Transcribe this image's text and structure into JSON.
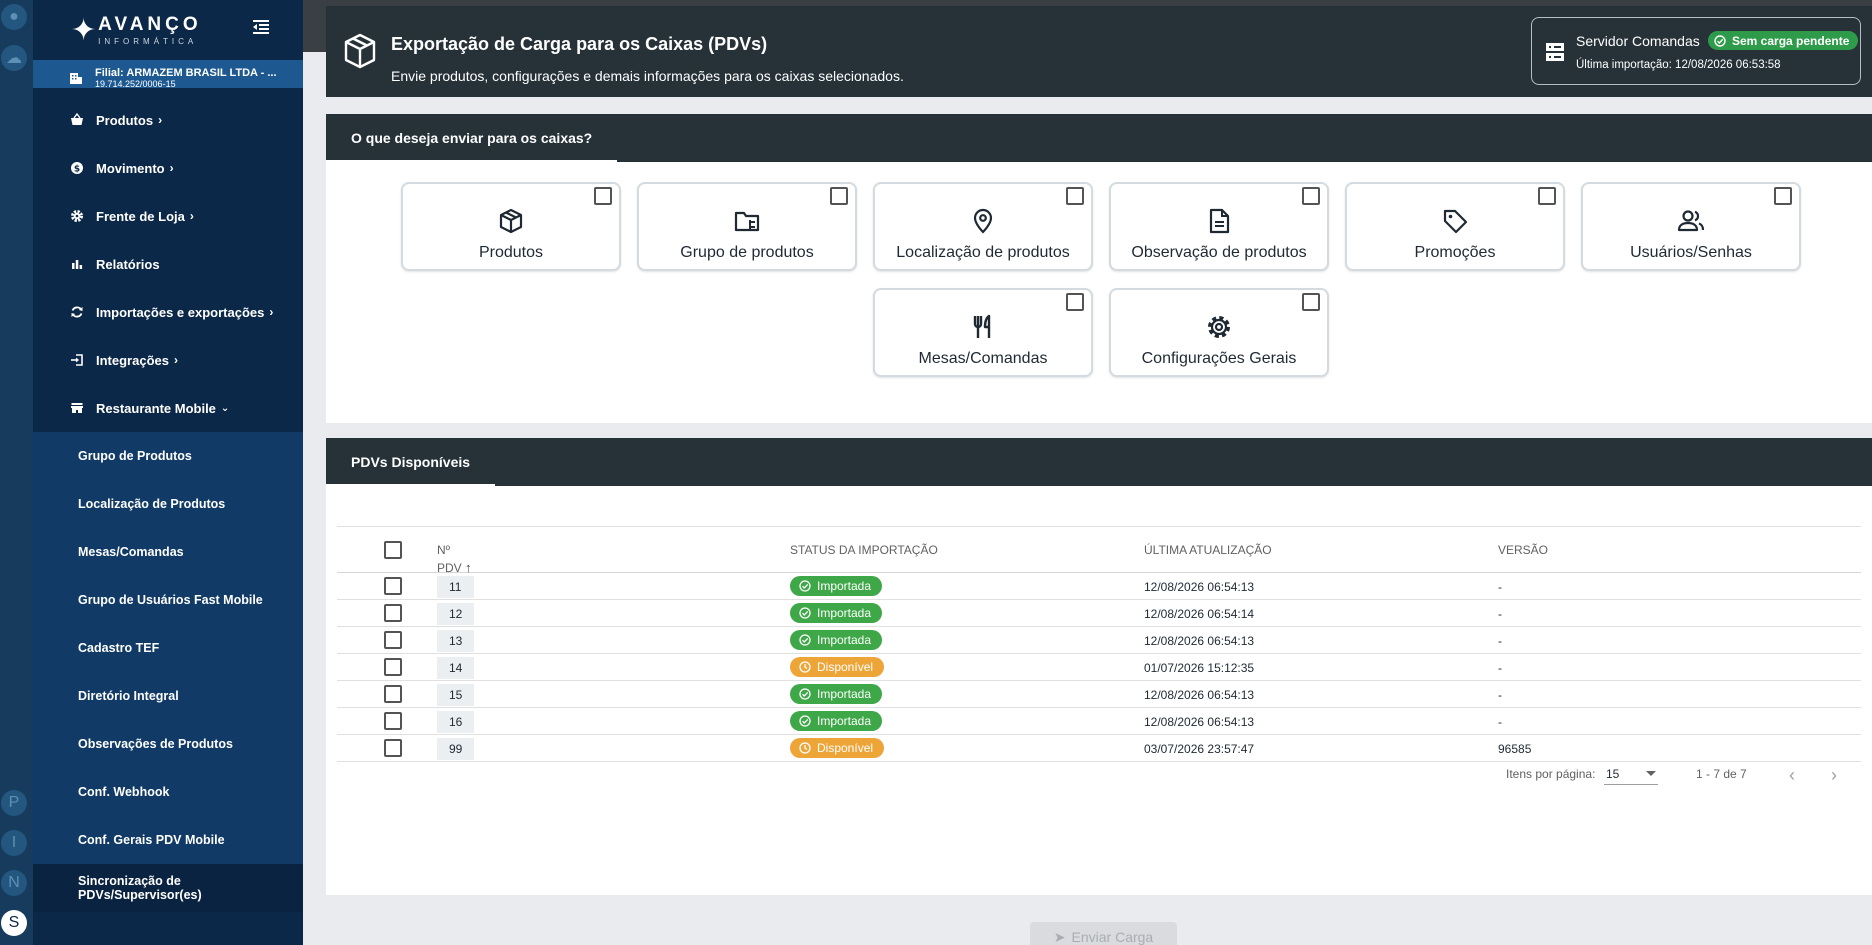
{
  "rail": {
    "items": [
      "P",
      "I",
      "N",
      "S"
    ]
  },
  "sidebar": {
    "logo_text": "AVANÇO",
    "logo_sub": "INFORMÁTICA",
    "filial_label": "Filial:",
    "filial_name": "ARMAZEM BRASIL LTDA - ...",
    "filial_cnpj": "19.714.252/0006-15",
    "items": [
      {
        "label": "Produtos",
        "icon": "basket-icon",
        "expandable": true
      },
      {
        "label": "Movimento",
        "icon": "coin-icon",
        "expandable": true
      },
      {
        "label": "Frente de Loja",
        "icon": "gear-icon",
        "expandable": true
      },
      {
        "label": "Relatórios",
        "icon": "bar-chart-icon",
        "expandable": false
      },
      {
        "label": "Importações e exportações",
        "icon": "sync-icon",
        "expandable": true
      },
      {
        "label": "Integrações",
        "icon": "login-icon",
        "expandable": true
      },
      {
        "label": "Restaurante Mobile",
        "icon": "store-icon",
        "expandable": true
      }
    ],
    "subitems": [
      "Grupo de Produtos",
      "Localização de Produtos",
      "Mesas/Comandas",
      "Grupo de Usuários Fast Mobile",
      "Cadastro TEF",
      "Diretório Integral",
      "Observações de Produtos",
      "Conf. Webhook",
      "Conf. Gerais PDV Mobile",
      "Sincronização de PDVs/Supervisor(es)"
    ]
  },
  "header": {
    "title": "Exportação de Carga para os Caixas (PDVs)",
    "subtitle": "Envie produtos, configurações e demais informações para os caixas selecionados.",
    "server_title": "Servidor Comandas",
    "server_badge": "Sem carga pendente",
    "last_import": "Última importação: 12/08/2026 06:53:58"
  },
  "options_panel": {
    "tab": "O que deseja enviar para os caixas?",
    "options": [
      {
        "label": "Produtos",
        "icon": "box-icon"
      },
      {
        "label": "Grupo de produtos",
        "icon": "folder-tree-icon"
      },
      {
        "label": "Localização de produtos",
        "icon": "location-pin-icon"
      },
      {
        "label": "Observação de produtos",
        "icon": "document-icon"
      },
      {
        "label": "Promoções",
        "icon": "tag-icon"
      },
      {
        "label": "Usuários/Senhas",
        "icon": "users-icon"
      },
      {
        "label": "Mesas/Comandas",
        "icon": "cutlery-icon"
      },
      {
        "label": "Configurações Gerais",
        "icon": "gear-icon"
      }
    ]
  },
  "pdv_panel": {
    "tab": "PDVs Disponíveis",
    "columns": {
      "num": "Nº PDV",
      "status": "STATUS DA IMPORTAÇÃO",
      "date": "ÚLTIMA ATUALIZAÇÃO",
      "version": "VERSÃO"
    },
    "rows": [
      {
        "num": "11",
        "status": "Importada",
        "kind": "ok",
        "date": "12/08/2026 06:54:13",
        "version": "-"
      },
      {
        "num": "12",
        "status": "Importada",
        "kind": "ok",
        "date": "12/08/2026 06:54:14",
        "version": "-"
      },
      {
        "num": "13",
        "status": "Importada",
        "kind": "ok",
        "date": "12/08/2026 06:54:13",
        "version": "-"
      },
      {
        "num": "14",
        "status": "Disponível",
        "kind": "av",
        "date": "01/07/2026 15:12:35",
        "version": "-"
      },
      {
        "num": "15",
        "status": "Importada",
        "kind": "ok",
        "date": "12/08/2026 06:54:13",
        "version": "-"
      },
      {
        "num": "16",
        "status": "Importada",
        "kind": "ok",
        "date": "12/08/2026 06:54:13",
        "version": "-"
      },
      {
        "num": "99",
        "status": "Disponível",
        "kind": "av",
        "date": "03/07/2026 23:57:47",
        "version": "96585"
      }
    ],
    "paginator": {
      "label": "Itens por página:",
      "page_size": "15",
      "range": "1 - 7 de 7"
    }
  },
  "send_button": "Enviar Carga",
  "colors": {
    "sidebar": "#0c2848",
    "header": "#263238",
    "ok": "#3ea748",
    "available": "#eea538",
    "badge": "#2e9b4a"
  }
}
